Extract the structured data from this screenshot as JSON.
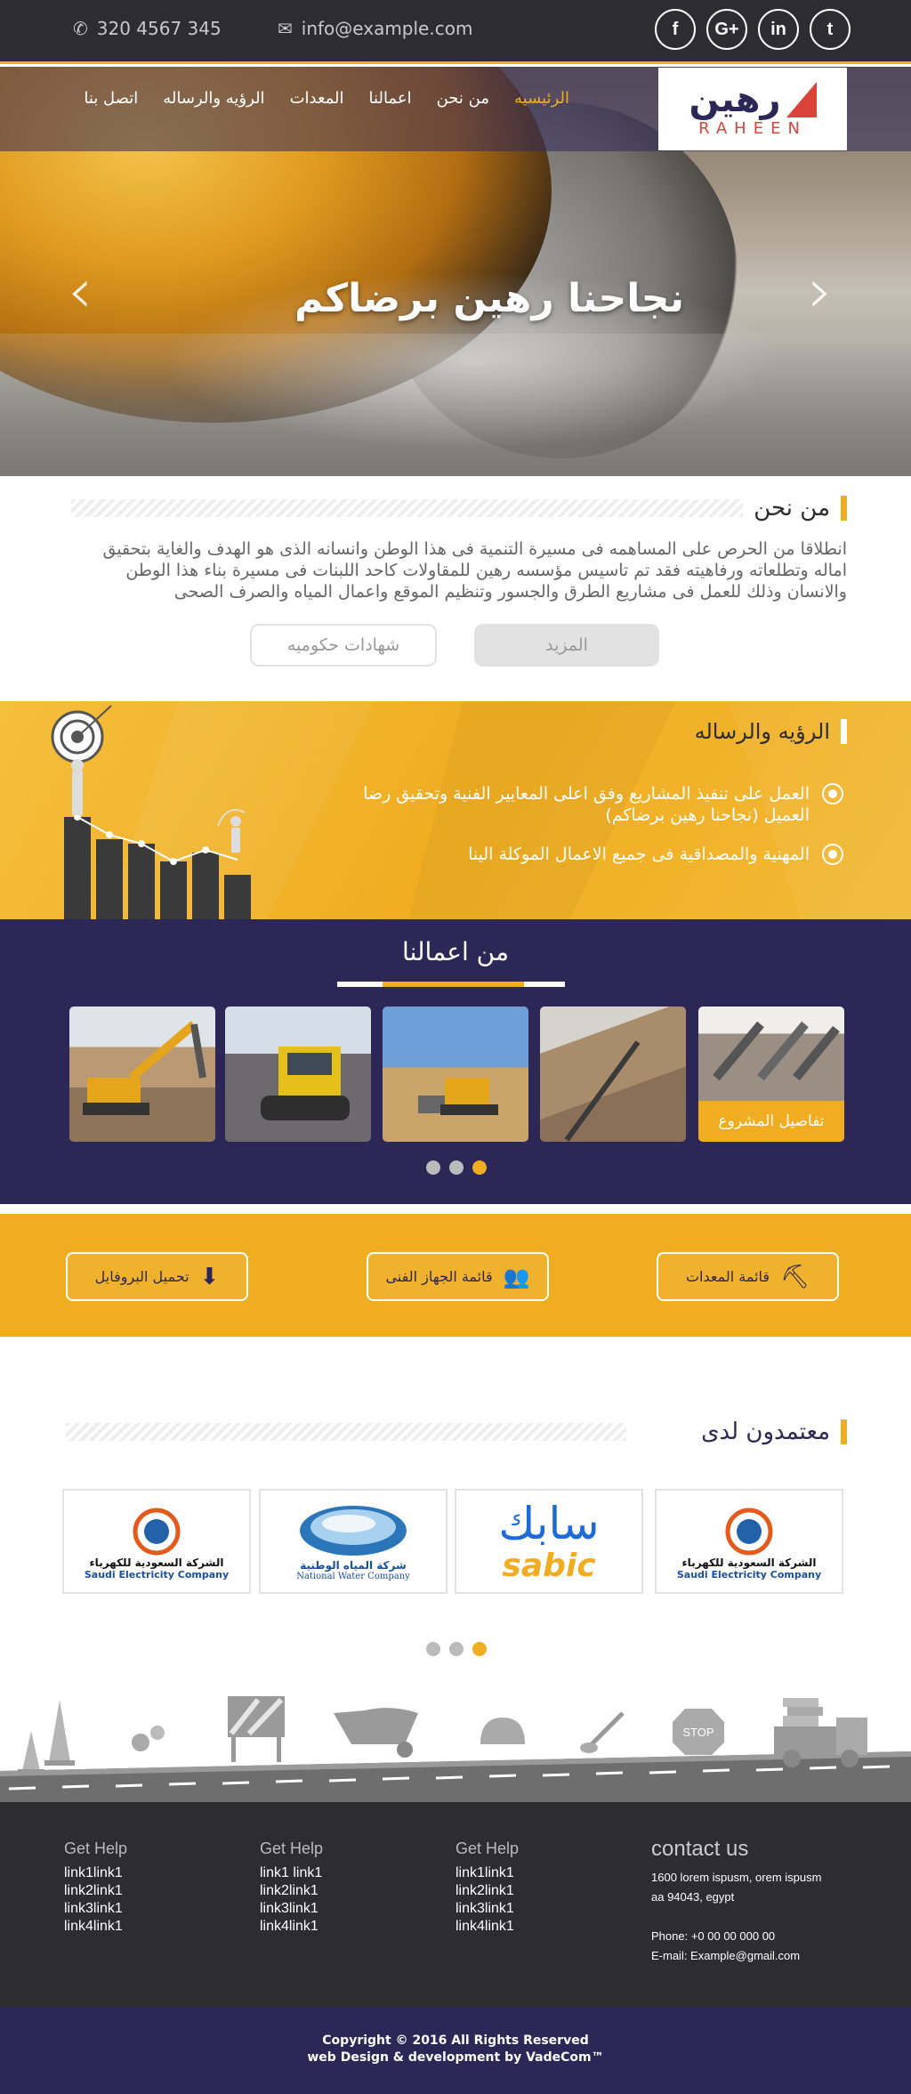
{
  "topbar": {
    "phone": "320 4567 345",
    "email": "info@example.com",
    "social": [
      "f",
      "G+",
      "in",
      "t"
    ],
    "social_names": [
      "facebook-icon",
      "google-plus-icon",
      "linkedin-icon",
      "twitter-icon"
    ]
  },
  "logo": {
    "arabic": "رهين",
    "latin": "RAHEEN"
  },
  "nav": [
    "الرئيسيه",
    "من نحن",
    "اعمالنا",
    "المعدات",
    "الرؤيه والرساله",
    "اتصل بنا"
  ],
  "hero": {
    "title": "نجاحنا رهين برضاكم",
    "prev": "‹",
    "next": "›"
  },
  "about": {
    "title": "من نحن",
    "text": "انطلاقا من الحرص على المساهمه فى مسيرة التنمية فى هذا الوطن وانسانه الذى هو الهدف والغاية بتحقيق اماله وتطلعاته ورفاهيته فقد تم تاسيس مؤسسه رهين للمقاولات كاحد اللبنات فى مسيرة بناء هذا الوطن والانسان وذلك للعمل فى مشاريع الطرق والجسور وتنظيم الموقع واعمال المياه والصرف الصحى",
    "more_btn": "المزيد",
    "certs_btn": "شهادات حكوميه"
  },
  "vision": {
    "title": "الرؤيه والرساله",
    "items": [
      "العمل على تنفيذ المشاريع وفق اعلى المعايير الفنية وتحقيق رضا العميل (نجاحنا رهين برضاكم)",
      "المهنية والمصداقية فى جميع الاعمال الموكلة الينا"
    ]
  },
  "works": {
    "title": "من اعمالنا",
    "details_label": "تفاصيل المشروع",
    "dots": 3,
    "active_dot": 2
  },
  "downloads": [
    "قائمة المعدات",
    "قائمة الجهاز الفنى",
    "تحميل البروفايل"
  ],
  "partners": {
    "title": "معتمدون لدى",
    "logos": [
      {
        "ar": "الشركة السعودية للكهرباء",
        "en": "Saudi Electricity Company"
      },
      {
        "ar": "سابك",
        "en": "sabic"
      },
      {
        "ar": "شركة المياه الوطنية",
        "en": "National Water Company"
      },
      {
        "ar": "الشركة السعودية للكهرباء",
        "en": "Saudi Electricity Company"
      }
    ],
    "dots": 3,
    "active_dot": 2
  },
  "roadsign": "STOP",
  "footer": {
    "cols": [
      {
        "title": "Get Help",
        "links": [
          "link1link1",
          "link2link1",
          "link3link1",
          "link4link1"
        ]
      },
      {
        "title": "Get Help",
        "links": [
          "link1 link1",
          "link2link1",
          "link3link1",
          "link4link1"
        ]
      },
      {
        "title": "Get Help",
        "links": [
          "link1link1",
          "link2link1",
          "link3link1",
          "link4link1"
        ]
      }
    ],
    "contact_title": "contact us",
    "address1": "1600 lorem ispusm, orem ispusm",
    "address2": "aa 94043, egypt",
    "phone": "Phone: +0 00 00 000  00",
    "email": "E-mail: Example@gmail.com"
  },
  "copyright": {
    "line1": "Copyright © 2016 All Rights Reserved",
    "line2": "web Design & development by VadeCom™"
  },
  "colors": {
    "accent": "#f0ad22",
    "navy": "#2d2757",
    "dark": "#2d2d2f"
  }
}
